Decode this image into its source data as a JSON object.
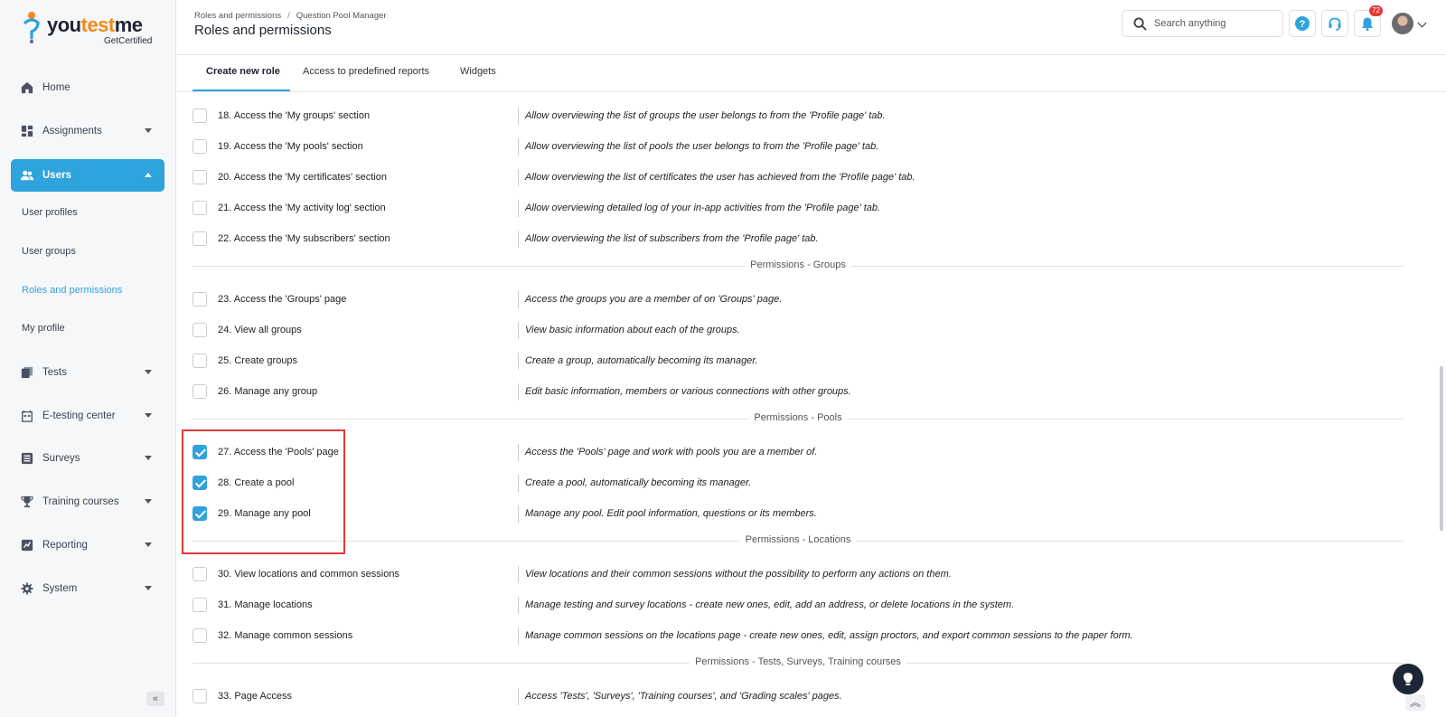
{
  "brand": {
    "name_part1": "you",
    "name_part2": "test",
    "name_part3": "me",
    "tagline": "GetCertified"
  },
  "sidebar": {
    "items": [
      {
        "label": "Home",
        "icon": "home-icon"
      },
      {
        "label": "Assignments",
        "icon": "dashboard-icon"
      },
      {
        "label": "Users",
        "icon": "users-icon"
      },
      {
        "label": "Tests",
        "icon": "tests-icon"
      },
      {
        "label": "E-testing center",
        "icon": "calendar-icon"
      },
      {
        "label": "Surveys",
        "icon": "list-icon"
      },
      {
        "label": "Training courses",
        "icon": "trophy-icon"
      },
      {
        "label": "Reporting",
        "icon": "report-icon"
      },
      {
        "label": "System",
        "icon": "gear-icon"
      }
    ],
    "users_sub": [
      "User profiles",
      "User groups",
      "Roles and permissions",
      "My profile"
    ],
    "collapse_glyph": "«"
  },
  "header": {
    "breadcrumb": [
      "Roles and permissions",
      "Question Pool Manager"
    ],
    "breadcrumb_sep": "/",
    "title": "Roles and permissions",
    "search_placeholder": "Search anything",
    "notification_count": "72"
  },
  "tabs": [
    "Create new role",
    "Access to predefined reports",
    "Widgets"
  ],
  "permissions": [
    {
      "name": "18. Access the 'My groups' section",
      "desc": "Allow overviewing the list of groups the user belongs to from the 'Profile page' tab.",
      "checked": false
    },
    {
      "name": "19. Access the 'My pools' section",
      "desc": "Allow overviewing the list of pools the user belongs to from the 'Profile page' tab.",
      "checked": false
    },
    {
      "name": "20. Access the 'My certificates' section",
      "desc": "Allow overviewing the list of certificates the user has achieved from the 'Profile page' tab.",
      "checked": false
    },
    {
      "name": "21. Access the 'My activity log' section",
      "desc": "Allow overviewing detailed log of your in-app activities from the 'Profile page' tab.",
      "checked": false
    },
    {
      "name": "22. Access the 'My subscribers' section",
      "desc": "Allow overviewing the list of subscribers from the 'Profile page' tab.",
      "checked": false
    },
    {
      "name": "23. Access the 'Groups' page",
      "desc": "Access the groups you are a member of on 'Groups' page.",
      "checked": false
    },
    {
      "name": "24. View all groups",
      "desc": "View basic information about each of the groups.",
      "checked": false
    },
    {
      "name": "25. Create groups",
      "desc": "Create a group, automatically becoming its manager.",
      "checked": false
    },
    {
      "name": "26. Manage any group",
      "desc": "Edit basic information, members or various connections with other groups.",
      "checked": false
    },
    {
      "name": "27. Access the 'Pools' page",
      "desc": "Access the 'Pools' page and work with pools you are a member of.",
      "checked": true
    },
    {
      "name": "28. Create a pool",
      "desc": "Create a pool, automatically becoming its manager.",
      "checked": true
    },
    {
      "name": "29. Manage any pool",
      "desc": "Manage any pool. Edit pool information, questions or its members.",
      "checked": true
    },
    {
      "name": "30. View locations and common sessions",
      "desc": "View locations and their common sessions without the possibility to perform any actions on them.",
      "checked": false
    },
    {
      "name": "31. Manage locations",
      "desc": "Manage testing and survey locations - create new ones, edit, add an address, or delete locations in the system.",
      "checked": false
    },
    {
      "name": "32. Manage common sessions",
      "desc": "Manage common sessions on the locations page - create new ones, edit, assign proctors, and export common sessions to the paper form.",
      "checked": false
    },
    {
      "name": "33. Page Access",
      "desc": "Access 'Tests', 'Surveys', 'Training courses', and 'Grading scales' pages.",
      "checked": false
    }
  ],
  "sections": [
    "Permissions - Groups",
    "Permissions - Pools",
    "Permissions - Locations",
    "Permissions - Tests, Surveys, Training courses"
  ],
  "colors": {
    "accent": "#2ea3dc",
    "highlight": "#e03a3a",
    "notification": "#e53935"
  },
  "scroll_to_top_glyph": "︽"
}
